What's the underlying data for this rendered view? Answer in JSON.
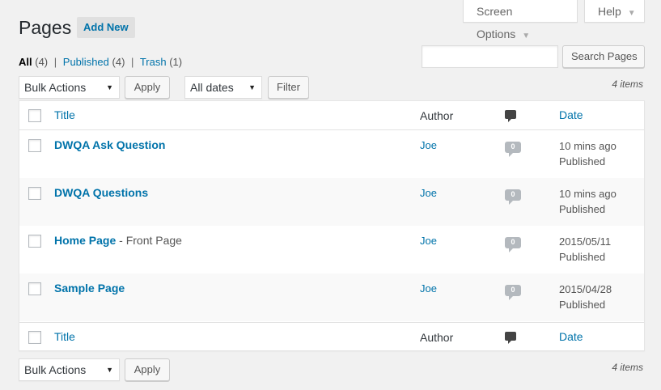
{
  "screen_options": {
    "label": "Screen Options",
    "caret": "▼"
  },
  "help": {
    "label": "Help",
    "caret": "▼"
  },
  "header": {
    "title": "Pages",
    "add_new": "Add New"
  },
  "views": {
    "all": {
      "label": "All",
      "count": "(4)"
    },
    "published": {
      "label": "Published",
      "count": "(4)"
    },
    "trash": {
      "label": "Trash",
      "count": "(1)"
    },
    "separator": "|"
  },
  "search": {
    "value": "",
    "placeholder": "",
    "button": "Search Pages"
  },
  "tablenav_top": {
    "bulk_actions": "Bulk Actions",
    "apply": "Apply",
    "dates": "All dates",
    "filter": "Filter",
    "items": "4 items"
  },
  "tablenav_bottom": {
    "bulk_actions": "Bulk Actions",
    "apply": "Apply",
    "items": "4 items"
  },
  "table": {
    "columns": {
      "title": "Title",
      "author": "Author",
      "comments_icon": "comment-icon",
      "date": "Date"
    },
    "rows": [
      {
        "title": "DWQA Ask Question",
        "state": "",
        "author": "Joe",
        "comments": "0",
        "date": "10 mins ago",
        "status": "Published"
      },
      {
        "title": "DWQA Questions",
        "state": "",
        "author": "Joe",
        "comments": "0",
        "date": "10 mins ago",
        "status": "Published"
      },
      {
        "title": "Home Page",
        "state": " - Front Page",
        "author": "Joe",
        "comments": "0",
        "date": "2015/05/11",
        "status": "Published"
      },
      {
        "title": "Sample Page",
        "state": "",
        "author": "Joe",
        "comments": "0",
        "date": "2015/04/28",
        "status": "Published"
      }
    ]
  },
  "colors": {
    "link": "#0073aa",
    "background": "#f1f1f1",
    "bubble": "#b4b9be"
  }
}
